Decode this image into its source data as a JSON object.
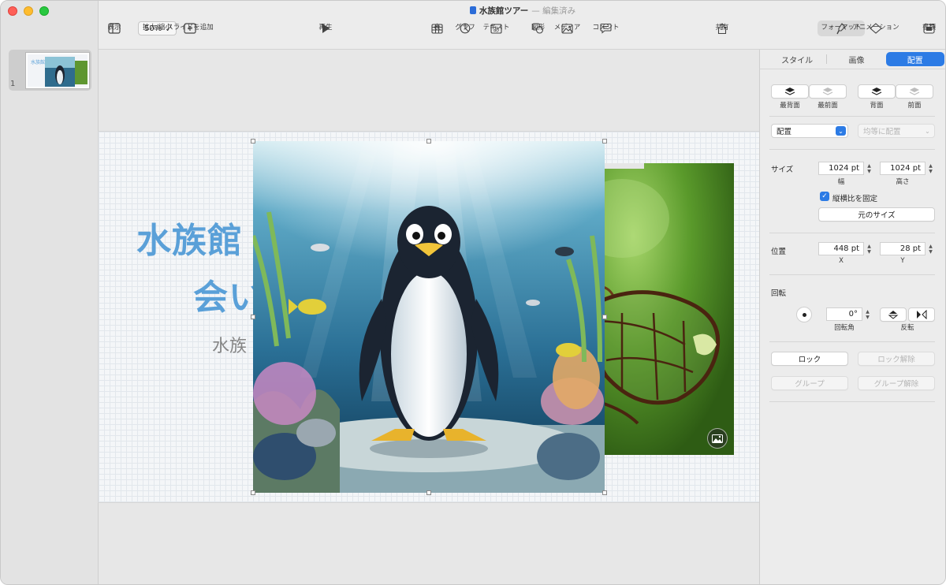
{
  "window": {
    "doc_title": "水族館ツアー",
    "doc_state": "— 編集済み"
  },
  "toolbar": {
    "view_label": "表示",
    "zoom_value": "50%",
    "zoom_label": "拡大/縮小",
    "add_slide_label": "スライドを追加",
    "play_label": "再生",
    "table_label": "表",
    "chart_label": "グラフ",
    "text_label": "テキスト",
    "shape_label": "図形",
    "media_label": "メディア",
    "comment_label": "コメント",
    "share_label": "共有",
    "format_label": "フォーマット",
    "animate_label": "アニメーション",
    "document_label": "書類"
  },
  "navigator": {
    "slides": [
      {
        "number": "1",
        "thumb_title": "水族館"
      }
    ]
  },
  "slide": {
    "title_line1": "水族館",
    "title_line2": "会い",
    "subtitle": "水族"
  },
  "inspector": {
    "tabs": [
      {
        "label": "スタイル",
        "selected": false
      },
      {
        "label": "画像",
        "selected": false
      },
      {
        "label": "配置",
        "selected": true
      }
    ],
    "layer_buttons": {
      "back": "最背面",
      "front": "最前面",
      "backward": "背面",
      "forward": "前面"
    },
    "align_popup": "配置",
    "distribute_popup": "均等に配置",
    "size": {
      "label": "サイズ",
      "width_value": "1024 pt",
      "width_label": "幅",
      "height_value": "1024 pt",
      "height_label": "高さ",
      "constrain_label": "縦横比を固定",
      "constrain_checked": true,
      "original_size_label": "元のサイズ"
    },
    "position": {
      "label": "位置",
      "x_value": "448 pt",
      "x_label": "X",
      "y_value": "28 pt",
      "y_label": "Y"
    },
    "rotate": {
      "label": "回転",
      "angle_value": "0°",
      "angle_label": "回転角",
      "flip_label": "反転"
    },
    "lock_label": "ロック",
    "unlock_label": "ロック解除",
    "group_label": "グループ",
    "ungroup_label": "グループ解除"
  },
  "colors": {
    "accent": "#2c7be5",
    "title_blue": "#5aa0d8"
  }
}
